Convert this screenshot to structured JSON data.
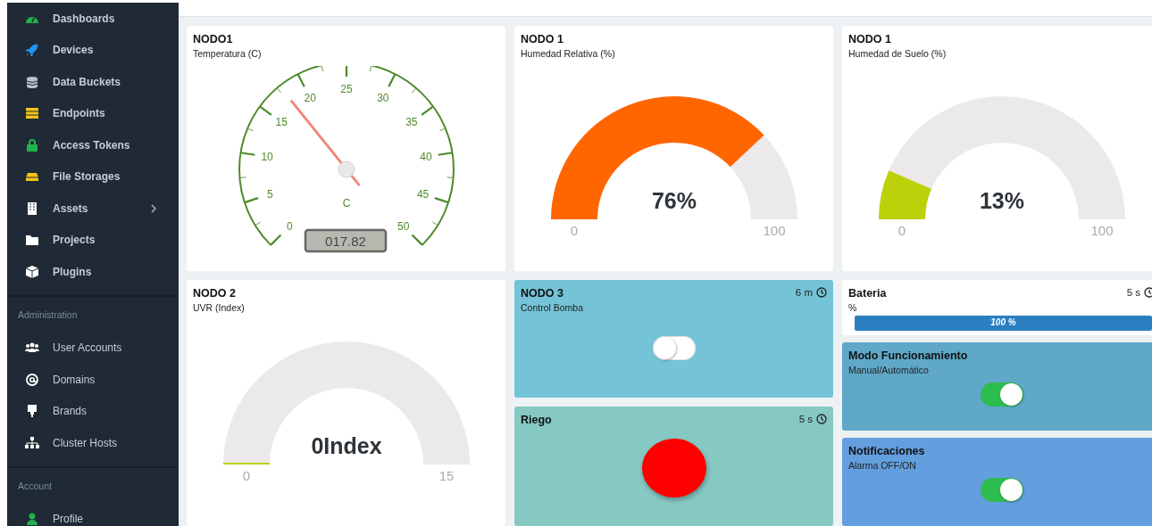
{
  "sidebar": {
    "sections": [
      {
        "items": [
          {
            "label": "Dashboards",
            "submenu": false
          },
          {
            "label": "Devices",
            "submenu": false
          },
          {
            "label": "Data Buckets",
            "submenu": false
          },
          {
            "label": "Endpoints",
            "submenu": false
          },
          {
            "label": "Access Tokens",
            "submenu": false
          },
          {
            "label": "File Storages",
            "submenu": false
          },
          {
            "label": "Assets",
            "submenu": true
          },
          {
            "label": "Projects",
            "submenu": false
          },
          {
            "label": "Plugins",
            "submenu": false
          }
        ]
      },
      {
        "title": "Administration",
        "items": [
          {
            "label": "User Accounts",
            "submenu": false
          },
          {
            "label": "Domains",
            "submenu": false
          },
          {
            "label": "Brands",
            "submenu": false
          },
          {
            "label": "Cluster Hosts",
            "submenu": false
          }
        ]
      },
      {
        "title": "Account",
        "items": [
          {
            "label": "Profile",
            "submenu": false
          }
        ]
      }
    ]
  },
  "rows": [
    {
      "columns": [
        {
          "widgets": [
            {
              "kind": "dial",
              "title": "NODO1",
              "subtitle": "Temperatura (C)",
              "scale": [
                "0",
                "5",
                "10",
                "15",
                "20",
                "25",
                "30",
                "35",
                "40",
                "45",
                "50"
              ],
              "unit": "C",
              "reading": "017.82"
            }
          ]
        },
        {
          "widgets": [
            {
              "kind": "half_gauge",
              "title": "NODO 1",
              "subtitle": "Humedad Relativa (%)",
              "color": "#ff6600",
              "value": "76%",
              "min": "0",
              "max": "100"
            }
          ]
        },
        {
          "widgets": [
            {
              "kind": "half_gauge",
              "title": "NODO 1",
              "subtitle": "Humedad de Suelo (%)",
              "color": "#bcd10a",
              "value": "13%",
              "min": "0",
              "max": "100"
            }
          ]
        }
      ]
    },
    {
      "columns": [
        {
          "widgets": [
            {
              "kind": "half_gauge",
              "title": "NODO 2",
              "subtitle": "UVR (Index)",
              "color": "#bcd10a",
              "value": "0Index",
              "min": "0",
              "max": "15"
            }
          ]
        },
        {
          "widgets": [
            {
              "kind": "switch",
              "title": "NODO 3",
              "subtitle": "Control Bomba",
              "age": "6 m",
              "on": false,
              "color": "#74c3d6"
            },
            {
              "kind": "indicator",
              "title": "Riego",
              "age": "5 s",
              "color": "#86c8c2"
            }
          ]
        },
        {
          "widgets": [
            {
              "kind": "progress",
              "title": "Bateria",
              "subtitle": "%",
              "age": "5 s",
              "level": 1,
              "reading": "100 %"
            },
            {
              "kind": "switch",
              "title": "Modo Funcionamiento",
              "subtitle": "Manual/Automático",
              "on": true,
              "color": "#5fa8c8"
            },
            {
              "kind": "switch",
              "title": "Notificaciones",
              "subtitle": "Alarma OFF/ON",
              "on": true,
              "color": "#639ede"
            }
          ]
        }
      ]
    }
  ]
}
